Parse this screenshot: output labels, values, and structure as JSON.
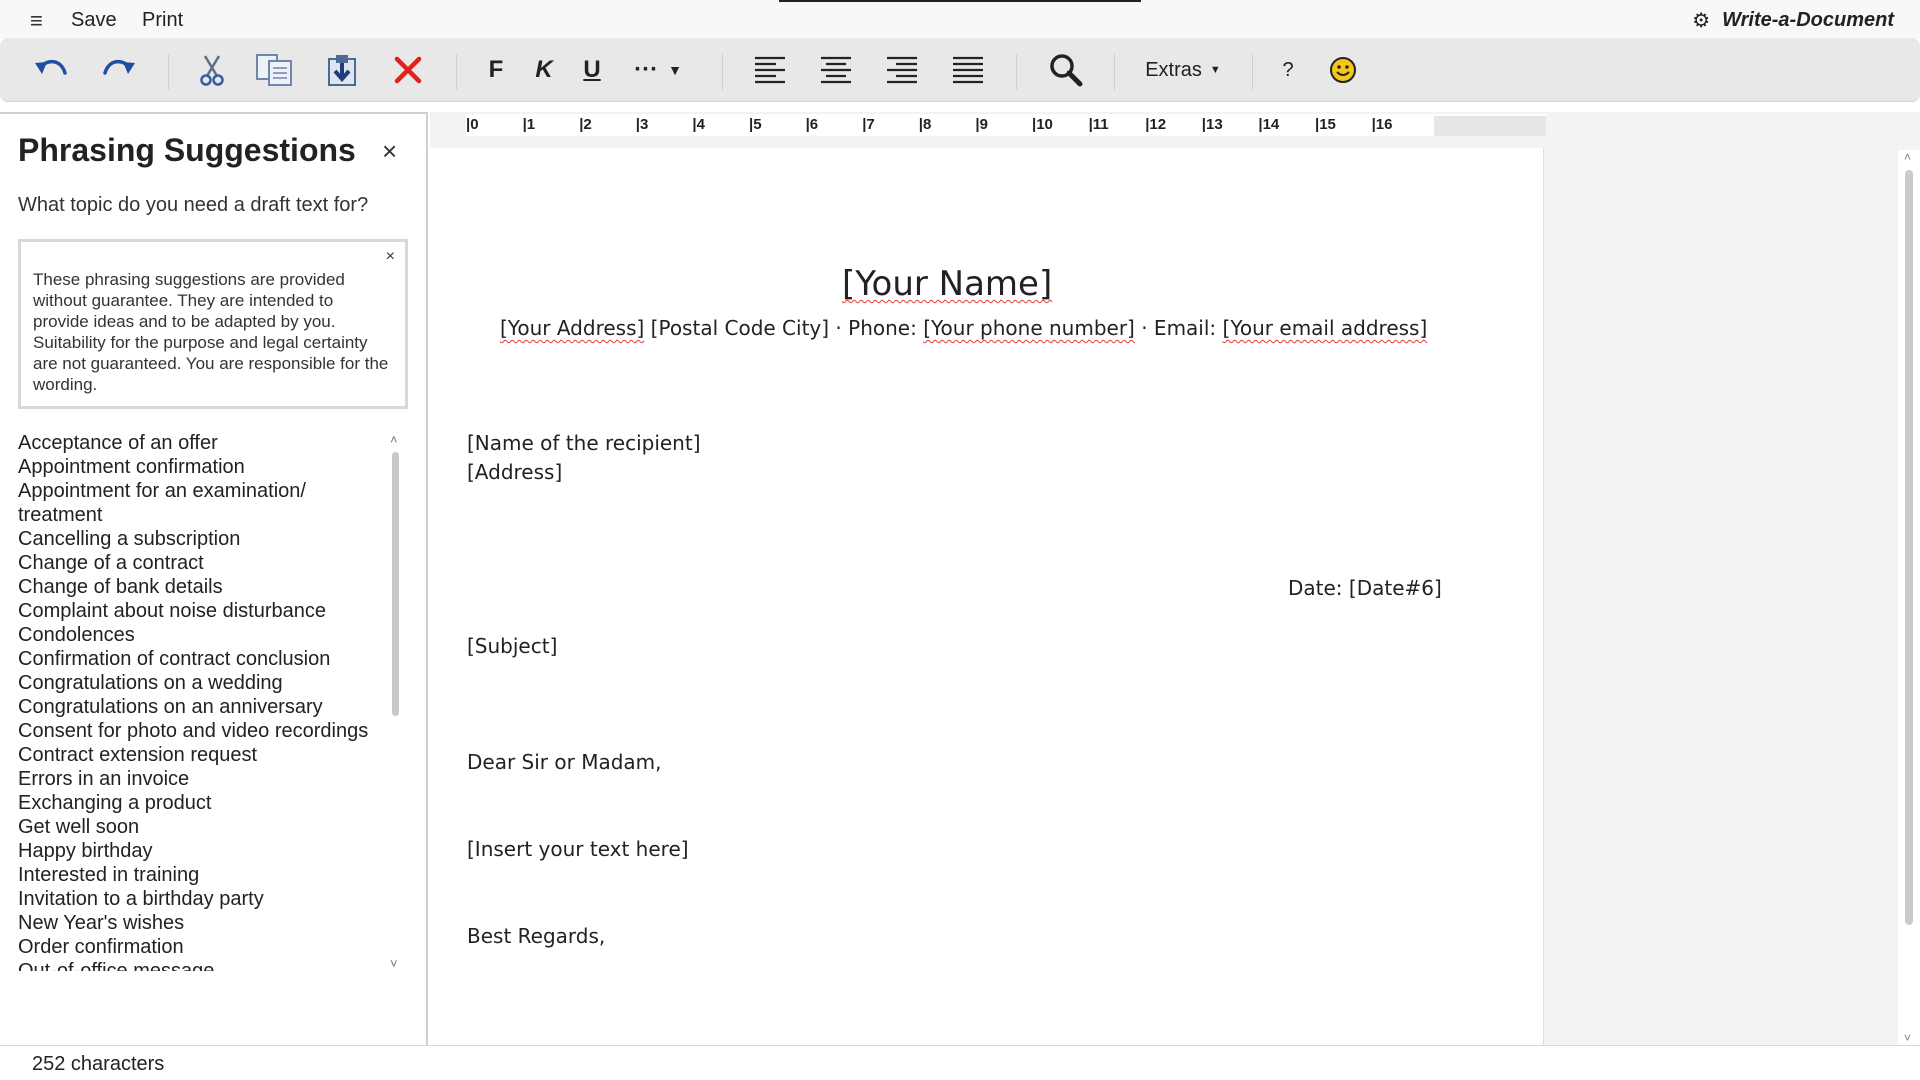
{
  "menu": {
    "save": "Save",
    "print": "Print",
    "app_title": "Write-a-Document"
  },
  "toolbar": {
    "bold": "F",
    "italic": "K",
    "underline": "U",
    "more": "···",
    "extras": "Extras",
    "help": "?",
    "icons": [
      "undo-icon",
      "redo-icon",
      "cut-icon",
      "copy-icon",
      "paste-icon",
      "delete-icon",
      "bold-icon",
      "italic-icon",
      "underline-icon",
      "more-icon",
      "align-left-icon",
      "align-center-icon",
      "align-right-icon",
      "align-justify-icon",
      "search-icon",
      "help-icon",
      "emoji-icon"
    ]
  },
  "colors": {
    "accent_blue": "#1e4fa3",
    "delete_red": "#e0221b",
    "emoji_yellow": "#f5c518",
    "spellcheck_red": "#e53935"
  },
  "panel": {
    "title": "Phrasing Suggestions",
    "close": "×",
    "question": "What topic do you need a draft text for?",
    "disclaimer": "These phrasing suggestions are provided without guarantee. They are intended to provide ideas and to be adapted by you. Suitability for the purpose and legal certainty are not guaranteed. You are responsible for the wording.",
    "disclaimer_close": "×",
    "topics": [
      "Acceptance of an offer",
      "Appointment confirmation",
      "Appointment for an examination/ treatment",
      "Cancelling a subscription",
      "Change of a contract",
      "Change of bank details",
      "Complaint about noise disturbance",
      "Condolences",
      "Confirmation of contract conclusion",
      "Congratulations on a wedding",
      "Congratulations on an anniversary",
      "Consent for photo and video recordings",
      "Contract extension request",
      "Errors in an invoice",
      "Exchanging a product",
      "Get well soon",
      "Happy birthday",
      "Interested in training",
      "Invitation to a birthday party",
      "New Year's wishes",
      "Order confirmation",
      "Out-of-office message"
    ]
  },
  "ruler": [
    "|0",
    "|1",
    "|2",
    "|3",
    "|4",
    "|5",
    "|6",
    "|7",
    "|8",
    "|9",
    "|10",
    "|11",
    "|12",
    "|13",
    "|14",
    "|15",
    "|16"
  ],
  "document": {
    "name": "[Your Name]",
    "address_line": {
      "address": "[Your Address]",
      "postal": "[Postal Code City]",
      "phone_label": "· Phone:",
      "phone": "[Your phone number]",
      "email_label": "· Email:",
      "email": "[Your email address]"
    },
    "recipient_name": "[Name of the recipient]",
    "recipient_address": "[Address]",
    "date": "Date: [Date#6]",
    "subject": "[Subject]",
    "salutation": "Dear Sir or Madam,",
    "body": "[Insert your text here]",
    "closing": "Best Regards,"
  },
  "status": {
    "char_count": "252 characters"
  }
}
